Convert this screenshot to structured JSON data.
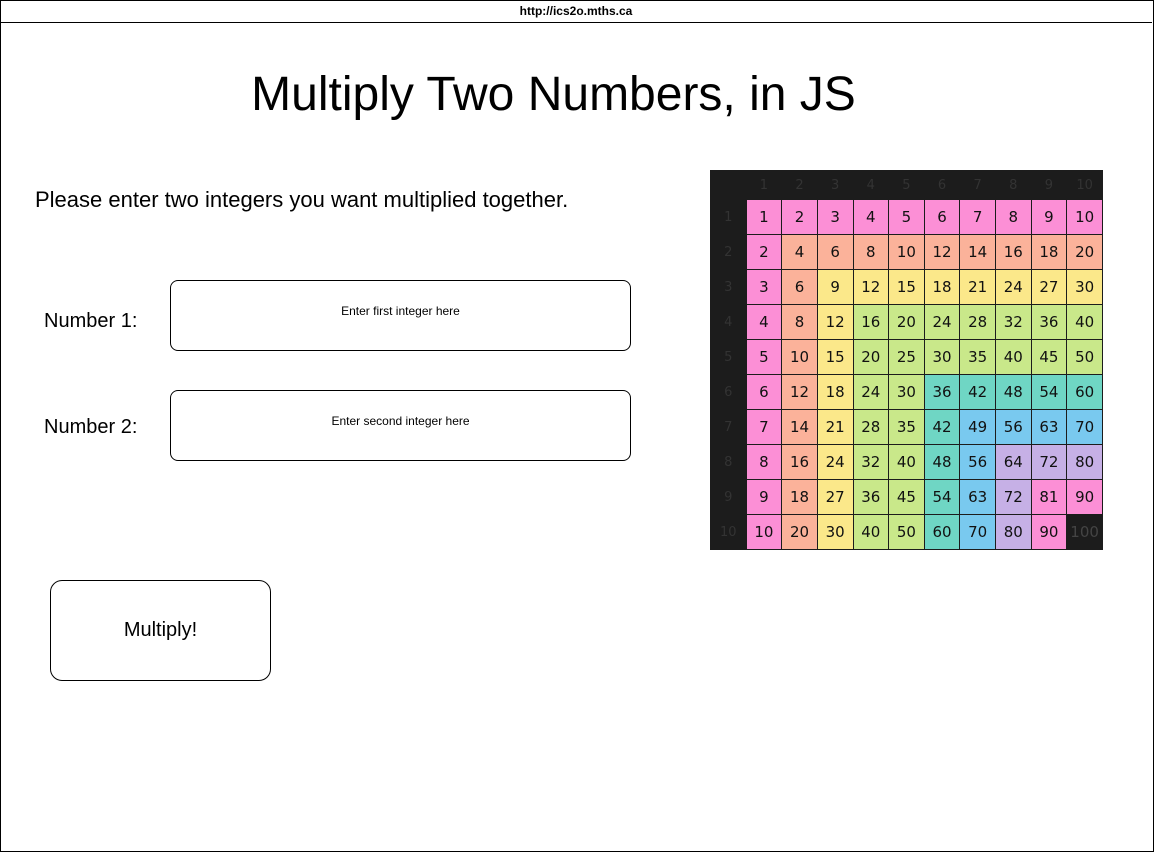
{
  "browser": {
    "url": "http://ics2o.mths.ca"
  },
  "page": {
    "title": "Multiply Two Numbers, in JS",
    "instructions": "Please enter two integers you want multiplied together."
  },
  "form": {
    "number1_label": "Number 1:",
    "number1_placeholder": "Enter first integer here",
    "number2_label": "Number 2:",
    "number2_placeholder": "Enter second integer here",
    "submit_label": "Multiply!"
  },
  "times_table": {
    "size": 10,
    "colors": {
      "pink": "#fc8fd6",
      "salmon": "#fbb29a",
      "yellow": "#fbe88a",
      "lime": "#c9e88a",
      "teal": "#6fd6c4",
      "blue": "#79c9ef",
      "lavender": "#c6b0e6",
      "dark": "#1c1c1c"
    }
  }
}
